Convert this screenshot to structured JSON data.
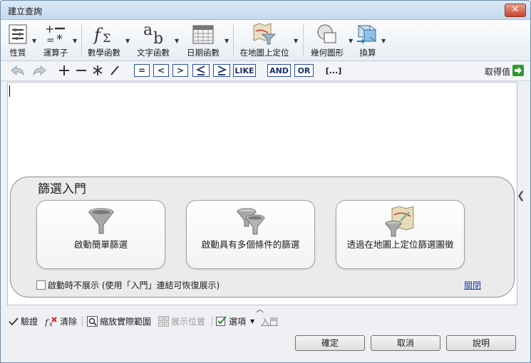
{
  "window": {
    "title": "建立查詢",
    "close_symbol": "✕"
  },
  "ribbon": {
    "properties": "性質",
    "operators": "運算子",
    "math_functions": "數學函數",
    "text_functions": "文字函數",
    "date_functions": "日期函數",
    "locate_on_map": "在地圖上定位",
    "geometry": "幾何圖形",
    "convert": "換算"
  },
  "toolbar": {
    "op_eq": "=",
    "op_lt": "<",
    "op_gt": ">",
    "op_like": "LIKE",
    "op_and": "AND",
    "op_or": "OR",
    "op_brackets": "[...]",
    "get_values": "取得值"
  },
  "getting_started": {
    "title": "篩選入門",
    "cards": [
      {
        "label": "啟動簡單篩選"
      },
      {
        "label": "啟動具有多個條件的篩選"
      },
      {
        "label": "透過在地圖上定位篩選圖徵"
      }
    ],
    "dont_show_label": "啟動時不展示 (使用「入門」連結可恢復展示)",
    "close_link": "關閉"
  },
  "bottom_bar": {
    "verify": "驗證",
    "clear": "清除",
    "zoom_to_extent": "縮放實際範圍",
    "show_location": "展示位置",
    "options": "選項",
    "getting_started_link": "入門"
  },
  "buttons": {
    "ok": "確定",
    "cancel": "取消",
    "help": "說明"
  },
  "colors": {
    "link": "#1f3fb0",
    "operator_border": "#2b4fa2",
    "get_values_arrow": "#2e9a2e"
  }
}
